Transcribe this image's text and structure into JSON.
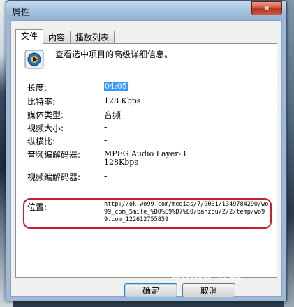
{
  "window": {
    "title": "属性",
    "close_glyph": "✕"
  },
  "tabs": [
    {
      "label": "文件",
      "active": true
    },
    {
      "label": "内容",
      "active": false
    },
    {
      "label": "播放列表",
      "active": false
    }
  ],
  "header": {
    "description": "查看选中项目的高级详细信息。"
  },
  "properties": {
    "duration": {
      "label": "长度:",
      "value": "04:05"
    },
    "bitrate": {
      "label": "比特率:",
      "value": "128 Kbps"
    },
    "media_type": {
      "label": "媒体类型:",
      "value": "音频"
    },
    "video_size": {
      "label": "视频大小:",
      "value": "-"
    },
    "aspect": {
      "label": "纵横比:",
      "value": "-"
    },
    "audio_codec": {
      "label": "音频编解码器:",
      "value_line1": "MPEG Audio Layer-3",
      "value_line2": "128Kbps"
    },
    "video_codec": {
      "label": "视频编解码器:",
      "value": "-"
    },
    "location": {
      "label": "位置:",
      "value": "http://ok.wo99.com/medias/7/9001/1349784290/wo99_com_Smile_%B0%E9%D7%E0/banzou/2/2/temp/wo99.com_122612755859"
    }
  },
  "buttons": {
    "ok": "确定",
    "cancel": "取消"
  },
  "watermark": "Baidu 经验",
  "colors": {
    "highlight_frame": "#c81e2b",
    "selection": "#3399ff"
  }
}
